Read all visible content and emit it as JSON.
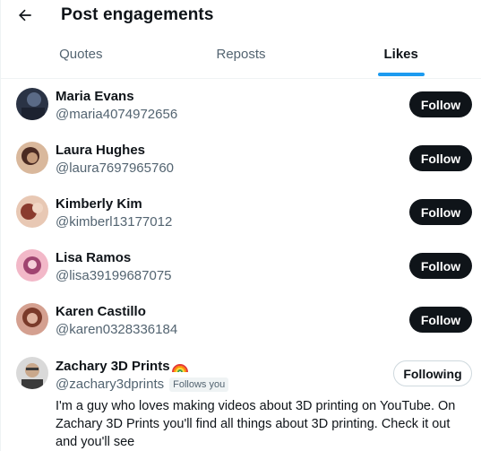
{
  "header": {
    "title": "Post engagements",
    "back_icon": "arrow-left-icon"
  },
  "tabs": [
    {
      "label": "Quotes",
      "active": false
    },
    {
      "label": "Reposts",
      "active": false
    },
    {
      "label": "Likes",
      "active": true
    }
  ],
  "colors": {
    "accent": "#1d9bf0",
    "text": "#0f1419",
    "secondary_text": "#536471",
    "follow_button_bg": "#0f1419"
  },
  "users": [
    {
      "name": "Maria Evans",
      "handle": "@maria4074972656",
      "button": "Follow",
      "avatar_colors": [
        "#2a3345",
        "#5a6a86"
      ]
    },
    {
      "name": "Laura Hughes",
      "handle": "@laura7697965760",
      "button": "Follow",
      "avatar_colors": [
        "#c49a7a",
        "#4a2a22"
      ]
    },
    {
      "name": "Kimberly Kim",
      "handle": "@kimberl13177012",
      "button": "Follow",
      "avatar_colors": [
        "#e8c8b4",
        "#8a3b2e"
      ]
    },
    {
      "name": "Lisa Ramos",
      "handle": "@lisa39199687075",
      "button": "Follow",
      "avatar_colors": [
        "#f2b8c8",
        "#a04470"
      ]
    },
    {
      "name": "Karen Castillo",
      "handle": "@karen0328336184",
      "button": "Follow",
      "avatar_colors": [
        "#7a3a2a",
        "#d4a090"
      ]
    }
  ],
  "last_user": {
    "name": "Zachary 3D Prints",
    "emoji": "rainbow-icon",
    "handle": "@zachary3dprints",
    "badge": "Follows you",
    "button": "Following",
    "bio": "I'm a guy who loves making videos about 3D printing on YouTube. On Zachary 3D Prints you'll find all things about 3D printing. Check it out and you'll see",
    "avatar_colors": [
      "#d9d9d9",
      "#3a3a3a"
    ]
  }
}
